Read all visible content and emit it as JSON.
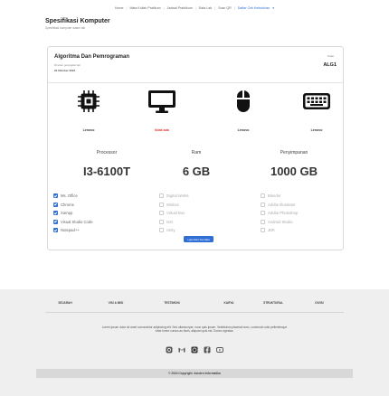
{
  "topnav": {
    "items": [
      "Home",
      "Mata Kuliah Pratikum",
      "Jadwal Praktikum",
      "Data Lab",
      "Scan QR",
      "Daftar Cek Kebutuhan"
    ],
    "active": "Daftar Cek Kebutuhan"
  },
  "page": {
    "title": "Spesifikasi Komputer",
    "subtitle": "Spesifikasi komputer dalam lab"
  },
  "card": {
    "title": "Algoritma Dan Pemrograman",
    "subtitle": "Rincian perangkat lab",
    "date": "20 Oktober 2024",
    "code_label": "Kode",
    "code_value": "ALG1",
    "icons": [
      {
        "name": "cpu-icon"
      },
      {
        "name": "monitor-icon"
      },
      {
        "name": "mouse-icon"
      },
      {
        "name": "keyboard-icon"
      }
    ],
    "brands": [
      {
        "label": "Lenovo",
        "color": "#333333"
      },
      {
        "label": "tidak ada",
        "color": "#e03131"
      },
      {
        "label": "Lenovo",
        "color": "#333333"
      },
      {
        "label": "Lenovo",
        "color": "#333333"
      }
    ],
    "specs": [
      {
        "label": "Processor",
        "value": "I3-6100T"
      },
      {
        "label": "Ram",
        "value": "6 GB"
      },
      {
        "label": "Penyimpanan",
        "value": "1000 GB"
      }
    ],
    "software": [
      [
        {
          "label": "Ms. Office",
          "checked": true
        },
        {
          "label": "Chrome",
          "checked": true
        },
        {
          "label": "Xampp",
          "checked": true
        },
        {
          "label": "Visual Studio Code",
          "checked": true
        },
        {
          "label": "Notepad++",
          "checked": true
        }
      ],
      [
        {
          "label": "Digital Works",
          "checked": false
        },
        {
          "label": "Winbox",
          "checked": false
        },
        {
          "label": "Virtual Box",
          "checked": false
        },
        {
          "label": "ISO",
          "checked": false
        },
        {
          "label": "Unity",
          "checked": false
        }
      ],
      [
        {
          "label": "Blender",
          "checked": false
        },
        {
          "label": "Adobe Illustrator",
          "checked": false
        },
        {
          "label": "Adobe Photoshop",
          "checked": false
        },
        {
          "label": "Android Studio",
          "checked": false
        },
        {
          "label": "JDK",
          "checked": false
        }
      ]
    ],
    "report_button": "Laporkan Kendala"
  },
  "footer": {
    "nav": [
      "SEJARAH",
      "VISI & MISI",
      "TESTIMONI",
      "KARYA",
      "STRUKTURAL",
      "DIVISI"
    ],
    "description": "Lorem ipsum dolor sit amet consectetur adipiscing elit. Sed ullamcorper, nunc quis ipsum. Vestibulum placerat nunc, commodo odio pellentesque vitae lorem cursus ac diam, aliquam quis est. Donec egestas.",
    "socials": [
      {
        "name": "instagram-icon",
        "color": "#555555"
      },
      {
        "name": "gmail-icon",
        "color": "#555555"
      },
      {
        "name": "whatsapp-icon",
        "color": "#333333"
      },
      {
        "name": "facebook-icon",
        "color": "#555555"
      },
      {
        "name": "youtube-icon",
        "color": "#555555"
      }
    ],
    "copyright": "© 2024 Copyright: Asisten Informatika"
  },
  "colors": {
    "accent": "#2f6fd6",
    "danger": "#e03131",
    "footer_bg": "#efefef"
  }
}
